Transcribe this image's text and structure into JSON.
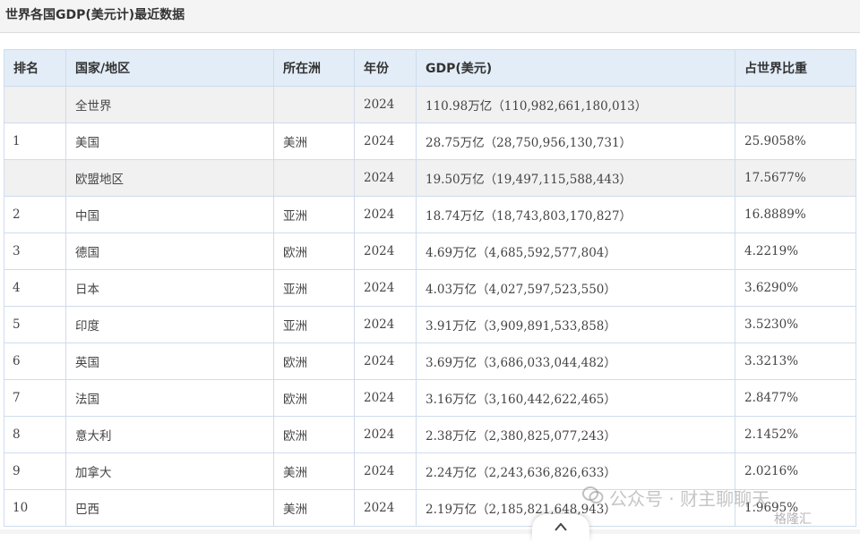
{
  "header": {
    "title": "世界各国GDP(美元计)最近数据"
  },
  "table": {
    "columns": [
      "排名",
      "国家/地区",
      "所在洲",
      "年份",
      "GDP(美元)",
      "占世界比重"
    ],
    "rows": [
      {
        "rank": "",
        "country": "全世界",
        "continent": "",
        "year": "2024",
        "gdp": "110.98万亿（110,982,661,180,013）",
        "share": ""
      },
      {
        "rank": "1",
        "country": "美国",
        "continent": "美洲",
        "year": "2024",
        "gdp": "28.75万亿（28,750,956,130,731）",
        "share": "25.9058%"
      },
      {
        "rank": "",
        "country": "欧盟地区",
        "continent": "",
        "year": "2024",
        "gdp": "19.50万亿（19,497,115,588,443）",
        "share": "17.5677%"
      },
      {
        "rank": "2",
        "country": "中国",
        "continent": "亚洲",
        "year": "2024",
        "gdp": "18.74万亿（18,743,803,170,827）",
        "share": "16.8889%"
      },
      {
        "rank": "3",
        "country": "德国",
        "continent": "欧洲",
        "year": "2024",
        "gdp": "4.69万亿（4,685,592,577,804）",
        "share": "4.2219%"
      },
      {
        "rank": "4",
        "country": "日本",
        "continent": "亚洲",
        "year": "2024",
        "gdp": "4.03万亿（4,027,597,523,550）",
        "share": "3.6290%"
      },
      {
        "rank": "5",
        "country": "印度",
        "continent": "亚洲",
        "year": "2024",
        "gdp": "3.91万亿（3,909,891,533,858）",
        "share": "3.5230%"
      },
      {
        "rank": "6",
        "country": "英国",
        "continent": "欧洲",
        "year": "2024",
        "gdp": "3.69万亿（3,686,033,044,482）",
        "share": "3.3213%"
      },
      {
        "rank": "7",
        "country": "法国",
        "continent": "欧洲",
        "year": "2024",
        "gdp": "3.16万亿（3,160,442,622,465）",
        "share": "2.8477%"
      },
      {
        "rank": "8",
        "country": "意大利",
        "continent": "欧洲",
        "year": "2024",
        "gdp": "2.38万亿（2,380,825,077,243）",
        "share": "2.1452%"
      },
      {
        "rank": "9",
        "country": "加拿大",
        "continent": "美洲",
        "year": "2024",
        "gdp": "2.24万亿（2,243,636,826,633）",
        "share": "2.0216%"
      },
      {
        "rank": "10",
        "country": "巴西",
        "continent": "美洲",
        "year": "2024",
        "gdp": "2.19万亿（2,185,821,648,943）",
        "share": "1.9695%"
      }
    ]
  },
  "watermark": {
    "text": "公众号 · 财主聊聊天",
    "brand": "格隆汇"
  },
  "icons": {
    "scroll_up": "chevron-up-icon",
    "wechat": "wechat-icon"
  }
}
